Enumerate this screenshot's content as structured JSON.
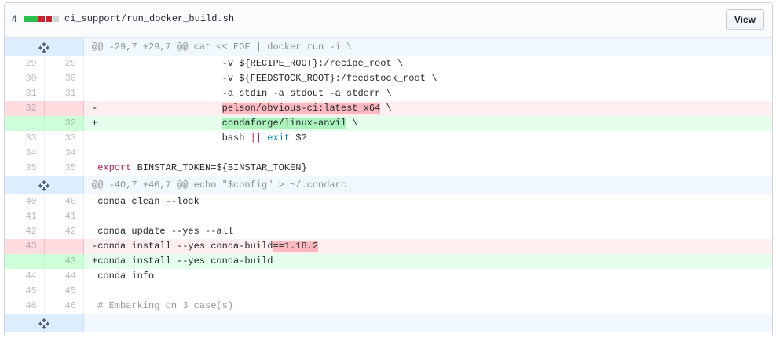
{
  "header": {
    "diff_count": "4",
    "diffstat_colors": [
      "#2cbe4e",
      "#2cbe4e",
      "#cb2431",
      "#cb2431",
      "#d1d5da"
    ],
    "file_path": "ci_support/run_docker_build.sh",
    "view_label": "View"
  },
  "hunks": [
    {
      "header": "@@ -29,7 +29,7 @@ cat << EOF | docker run -i \\",
      "lines": [
        {
          "type": "ctx",
          "old": "29",
          "new": "29",
          "text": "                       -v ${RECIPE_ROOT}:/recipe_root \\"
        },
        {
          "type": "ctx",
          "old": "30",
          "new": "30",
          "text": "                       -v ${FEEDSTOCK_ROOT}:/feedstock_root \\"
        },
        {
          "type": "ctx",
          "old": "31",
          "new": "31",
          "text": "                       -a stdin -a stdout -a stderr \\"
        },
        {
          "type": "del",
          "old": "32",
          "new": "",
          "prefix": "-                      ",
          "hl": "pelson/obvious-ci:latest_x64",
          "suffix": " \\"
        },
        {
          "type": "add",
          "old": "",
          "new": "32",
          "prefix": "+                      ",
          "hl": "condaforge/linux-anvil",
          "suffix": " \\"
        },
        {
          "type": "ctx",
          "old": "33",
          "new": "33",
          "text": "                       bash || exit $?"
        },
        {
          "type": "ctx",
          "old": "34",
          "new": "34",
          "text": ""
        },
        {
          "type": "ctx",
          "old": "35",
          "new": "35",
          "text": " export BINSTAR_TOKEN=${BINSTAR_TOKEN}"
        }
      ]
    },
    {
      "header": "@@ -40,7 +40,7 @@ echo \"$config\" > ~/.condarc",
      "lines": [
        {
          "type": "ctx",
          "old": "40",
          "new": "40",
          "text": " conda clean --lock"
        },
        {
          "type": "ctx",
          "old": "41",
          "new": "41",
          "text": ""
        },
        {
          "type": "ctx",
          "old": "42",
          "new": "42",
          "text": " conda update --yes --all"
        },
        {
          "type": "del",
          "old": "43",
          "new": "",
          "prefix": "-conda install --yes conda-build",
          "hl": "==1.18.2",
          "suffix": ""
        },
        {
          "type": "add",
          "old": "",
          "new": "43",
          "prefix": "+conda install --yes conda-build",
          "hl": "",
          "suffix": ""
        },
        {
          "type": "ctx",
          "old": "44",
          "new": "44",
          "text": " conda info"
        },
        {
          "type": "ctx",
          "old": "45",
          "new": "45",
          "text": ""
        },
        {
          "type": "ctx",
          "old": "46",
          "new": "46",
          "text": " # Embarking on 3 case(s)."
        }
      ]
    }
  ]
}
